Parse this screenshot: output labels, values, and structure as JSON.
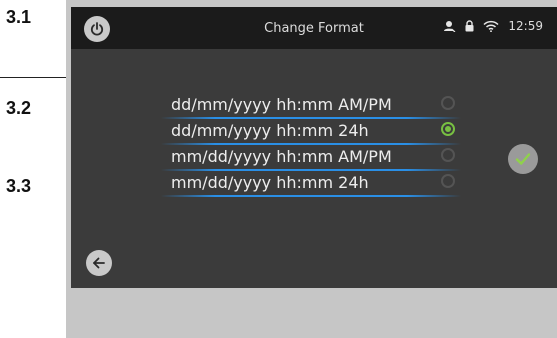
{
  "steps": [
    "3.1",
    "3.2",
    "3.3"
  ],
  "header": {
    "title": "Change Format",
    "time": "12:59"
  },
  "icons": {
    "power": "power-icon",
    "user": "user-icon",
    "lock": "lock-icon",
    "wifi": "wifi-icon",
    "confirm": "checkmark-icon",
    "back": "arrow-left-icon"
  },
  "options": [
    {
      "label": "dd/mm/yyyy  hh:mm  AM/PM",
      "selected": false
    },
    {
      "label": "dd/mm/yyyy  hh:mm  24h",
      "selected": true
    },
    {
      "label": "mm/dd/yyyy  hh:mm  AM/PM",
      "selected": false
    },
    {
      "label": "mm/dd/yyyy  hh:mm  24h",
      "selected": false
    }
  ],
  "colors": {
    "accent_green": "#78c042",
    "underline_blue": "#2a8fe6",
    "screen_bg": "#3b3b3b",
    "topbar_bg": "#1b1b1b"
  }
}
